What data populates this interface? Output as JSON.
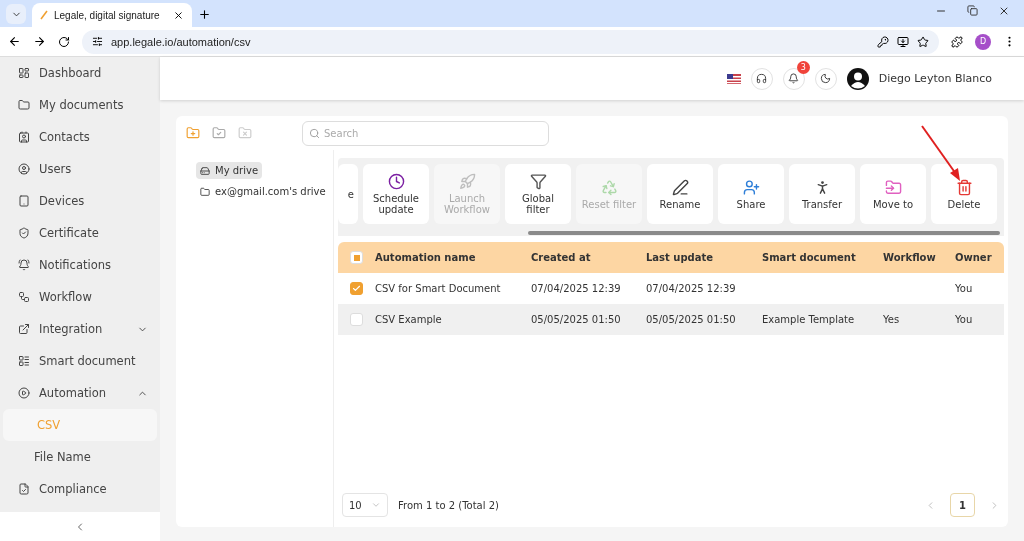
{
  "browser": {
    "tab_title": "Legale, digital signature",
    "url": "app.legale.io/automation/csv",
    "profile": "D"
  },
  "sidebar": {
    "items": [
      {
        "label": "Dashboard",
        "selected": false
      },
      {
        "label": "My documents",
        "selected": false
      },
      {
        "label": "Contacts",
        "selected": false
      },
      {
        "label": "Users",
        "selected": false
      },
      {
        "label": "Devices",
        "selected": false
      },
      {
        "label": "Certificate",
        "selected": false
      },
      {
        "label": "Notifications",
        "selected": false
      },
      {
        "label": "Workflow",
        "selected": false
      },
      {
        "label": "Integration",
        "selected": false,
        "expanded": false
      },
      {
        "label": "Smart document",
        "selected": false
      },
      {
        "label": "Automation",
        "selected": false,
        "expanded": true,
        "children": [
          {
            "label": "CSV",
            "selected": true
          },
          {
            "label": "File Name",
            "selected": false
          }
        ]
      },
      {
        "label": "Compliance",
        "selected": false
      }
    ]
  },
  "header": {
    "notification_count": "3",
    "user_name": "Diego Leyton Blanco"
  },
  "search": {
    "placeholder": "Search"
  },
  "drives": [
    {
      "label": "My drive",
      "selected": true
    },
    {
      "label": "ex@gmail.com's drive",
      "selected": false
    }
  ],
  "actions": [
    {
      "label": "e",
      "cut": true,
      "disabled": false
    },
    {
      "label": "Schedule update",
      "disabled": false
    },
    {
      "label": "Launch Workflow",
      "disabled": true
    },
    {
      "label": "Global filter",
      "disabled": false
    },
    {
      "label": "Reset filter",
      "disabled": true
    },
    {
      "label": "Rename",
      "disabled": false
    },
    {
      "label": "Share",
      "disabled": false
    },
    {
      "label": "Transfer",
      "disabled": false
    },
    {
      "label": "Move to",
      "disabled": false
    },
    {
      "label": "Delete",
      "disabled": false,
      "pointed": true
    }
  ],
  "table": {
    "select_all": {
      "indeterminate": true
    },
    "columns": [
      "Automation name",
      "Created at",
      "Last update",
      "Smart document",
      "Workflow",
      "Owner"
    ],
    "rows": [
      {
        "selected": true,
        "hovered": false,
        "cells": [
          "CSV for Smart Document",
          "07/04/2025 12:39",
          "07/04/2025 12:39",
          "",
          "",
          "You"
        ]
      },
      {
        "selected": false,
        "hovered": true,
        "cells": [
          "CSV Example",
          "05/05/2025 01:50",
          "05/05/2025 01:50",
          "Example Template",
          "Yes",
          "You"
        ]
      }
    ]
  },
  "pagination": {
    "page_size": "10",
    "summary": "From 1 to 2 (Total 2)",
    "pages": [
      {
        "label": "1",
        "selected": true
      }
    ]
  }
}
